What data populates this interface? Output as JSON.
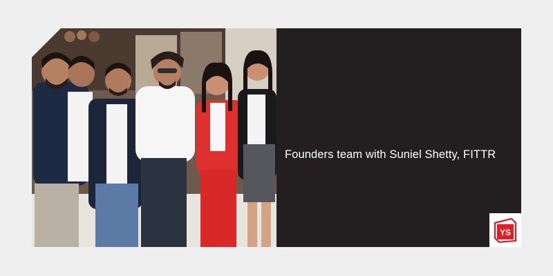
{
  "caption": "Founders team with Suniel Shetty, FITTR",
  "logo": {
    "text": "YS",
    "color": "#e11d25"
  },
  "photo": {
    "subject": "group-photo"
  },
  "colors": {
    "background": "#efefef",
    "panel": "#231f20",
    "text": "#ffffff"
  }
}
